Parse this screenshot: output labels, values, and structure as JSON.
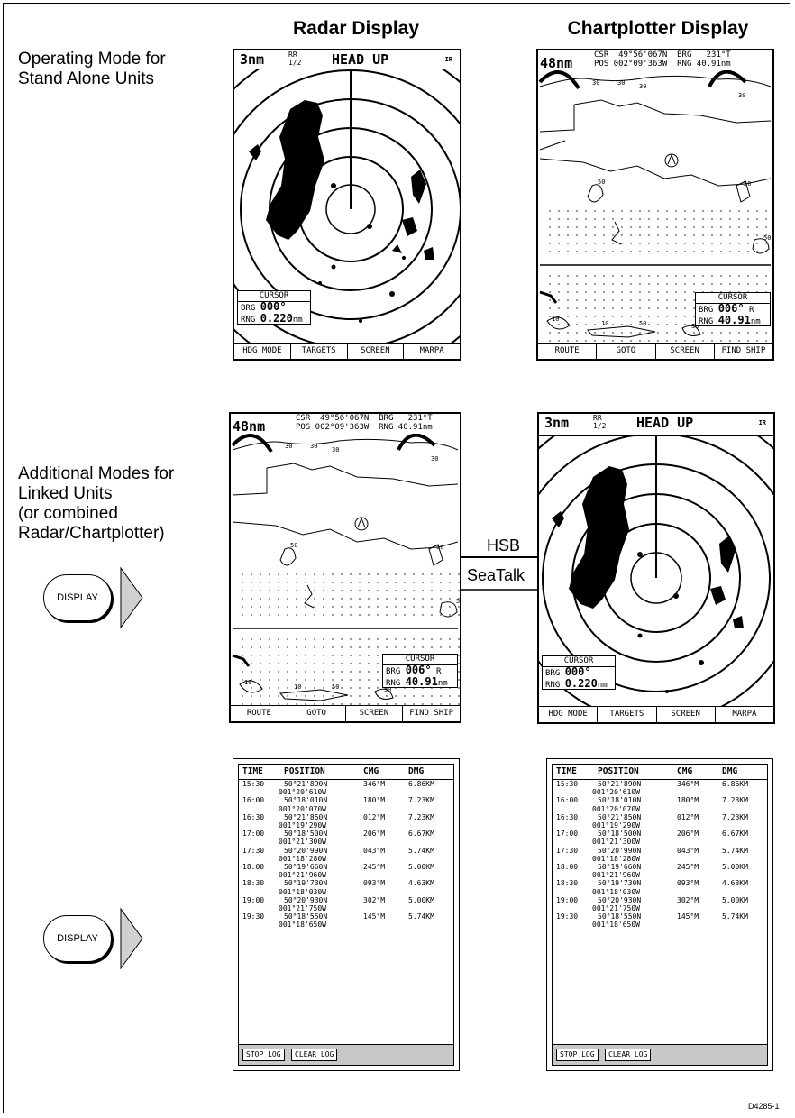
{
  "headings": {
    "radar": "Radar Display",
    "chartplotter": "Chartplotter Display"
  },
  "labels": {
    "standalone": "Operating Mode for\nStand Alone Units",
    "linked": "Additional Modes for\nLinked Units\n(or combined\nRadar/Chartplotter)"
  },
  "display_button": "DISPLAY",
  "links": {
    "hsb": "HSB",
    "seatalk": "SeaTalk"
  },
  "radar": {
    "range": "3nm",
    "rr_top": "RR",
    "rr_bottom": "1/2",
    "mode": "HEAD UP",
    "ir": "IR",
    "cursor_title": "CURSOR",
    "brg_label": "BRG",
    "brg_value": "000°",
    "rng_label": "RNG",
    "rng_value": "0.220",
    "rng_unit": "nm",
    "softkeys": [
      "HDG MODE",
      "TARGETS",
      "SCREEN",
      "MARPA"
    ]
  },
  "chart": {
    "range": "48nm",
    "line1": "CSR  49°56'067N  BRG   231°T",
    "line2": "POS 002°09'363W  RNG 40.91nm",
    "cursor_title": "CURSOR",
    "brg_label": "BRG",
    "brg_value": "006°",
    "brg_suffix": "R",
    "rng_label": "RNG",
    "rng_value": "40.91",
    "rng_unit": "nm",
    "softkeys": [
      "ROUTE",
      "GOTO",
      "SCREEN",
      "FIND SHIP"
    ],
    "depths": [
      "30",
      "30",
      "30",
      "30",
      "50",
      "50",
      "50",
      "10",
      "10",
      "50",
      "50"
    ]
  },
  "log": {
    "headers": [
      "TIME",
      "POSITION",
      "CMG",
      "DMG"
    ],
    "rows": [
      {
        "time": "15:30",
        "lat": "50°21'890N",
        "lon": "001°20'610W",
        "cmg": "346°M",
        "dmg": "6.86KM"
      },
      {
        "time": "16:00",
        "lat": "50°18'010N",
        "lon": "001°20'070W",
        "cmg": "180°M",
        "dmg": "7.23KM"
      },
      {
        "time": "16:30",
        "lat": "50°21'850N",
        "lon": "001°19'290W",
        "cmg": "012°M",
        "dmg": "7.23KM"
      },
      {
        "time": "17:00",
        "lat": "50°18'500N",
        "lon": "001°21'300W",
        "cmg": "206°M",
        "dmg": "6.67KM"
      },
      {
        "time": "17:30",
        "lat": "50°20'990N",
        "lon": "001°18'280W",
        "cmg": "043°M",
        "dmg": "5.74KM"
      },
      {
        "time": "18:00",
        "lat": "50°19'660N",
        "lon": "001°21'960W",
        "cmg": "245°M",
        "dmg": "5.00KM"
      },
      {
        "time": "18:30",
        "lat": "50°19'730N",
        "lon": "001°18'030W",
        "cmg": "093°M",
        "dmg": "4.63KM"
      },
      {
        "time": "19:00",
        "lat": "50°20'930N",
        "lon": "001°21'750W",
        "cmg": "302°M",
        "dmg": "5.00KM"
      },
      {
        "time": "19:30",
        "lat": "50°18'550N",
        "lon": "001°18'650W",
        "cmg": "145°M",
        "dmg": "5.74KM"
      }
    ],
    "softkeys": [
      "STOP LOG",
      "CLEAR LOG"
    ]
  },
  "reference": "D4285-1"
}
